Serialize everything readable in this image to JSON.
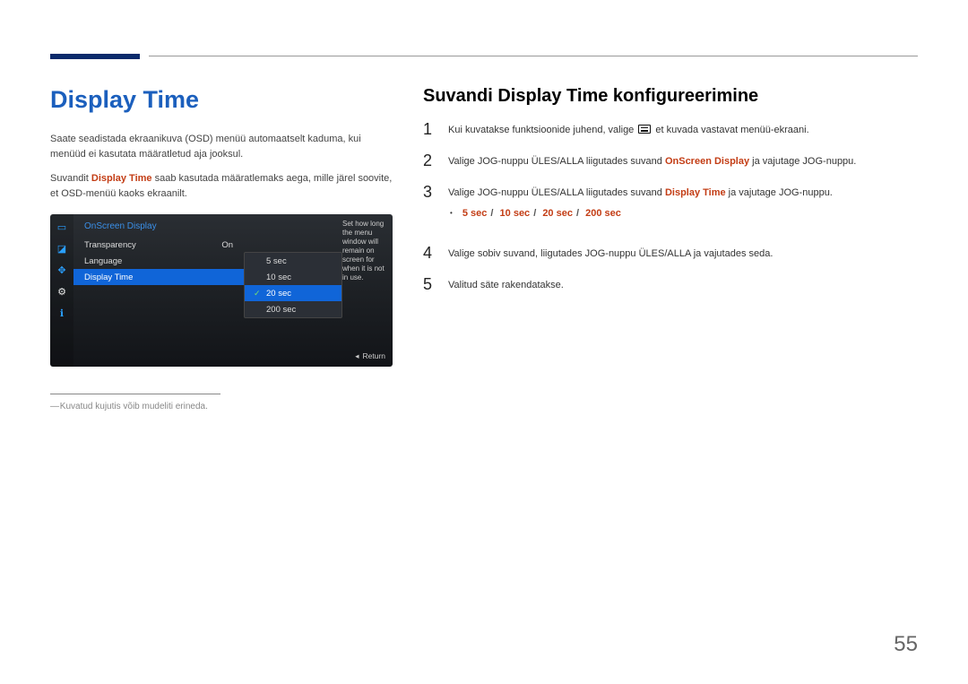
{
  "page_number": "55",
  "left": {
    "title": "Display Time",
    "para1": "Saate seadistada ekraanikuva (OSD) menüü automaatselt kaduma, kui menüüd ei kasutata määratletud aja jooksul.",
    "para2_pre": "Suvandit ",
    "para2_bold": "Display Time",
    "para2_post": " saab kasutada määratlemaks aega, mille järel soovite, et OSD-menüü kaoks ekraanilt.",
    "footnote": "Kuvatud kujutis võib mudeliti erineda."
  },
  "osd": {
    "heading": "OnScreen Display",
    "rows": [
      {
        "label": "Transparency",
        "value": "On",
        "selected": false
      },
      {
        "label": "Language",
        "value": "",
        "selected": false
      },
      {
        "label": "Display Time",
        "value": "",
        "selected": true
      }
    ],
    "submenu": [
      {
        "label": "5 sec",
        "selected": false,
        "checked": false
      },
      {
        "label": "10 sec",
        "selected": false,
        "checked": false
      },
      {
        "label": "20 sec",
        "selected": true,
        "checked": true
      },
      {
        "label": "200 sec",
        "selected": false,
        "checked": false
      }
    ],
    "help": "Set how long the menu window will remain on screen for when it is not in use.",
    "return": "Return"
  },
  "right": {
    "subtitle": "Suvandi Display Time konfigureerimine",
    "steps": {
      "s1_pre": "Kui kuvatakse funktsioonide juhend, valige ",
      "s1_post": " et kuvada vastavat menüü-ekraani.",
      "s2_pre": "Valige JOG-nuppu ÜLES/ALLA liigutades suvand ",
      "s2_bold": "OnScreen Display",
      "s2_post": " ja vajutage JOG-nuppu.",
      "s3_pre": "Valige JOG-nuppu ÜLES/ALLA liigutades suvand ",
      "s3_bold": "Display Time",
      "s3_post": " ja vajutage JOG-nuppu.",
      "opts": [
        "5 sec",
        "10 sec",
        "20 sec",
        "200 sec"
      ],
      "s4": "Valige sobiv suvand, liigutades JOG-nuppu ÜLES/ALLA ja vajutades seda.",
      "s5": "Valitud säte rakendatakse."
    },
    "nums": {
      "n1": "1",
      "n2": "2",
      "n3": "3",
      "n4": "4",
      "n5": "5"
    }
  }
}
